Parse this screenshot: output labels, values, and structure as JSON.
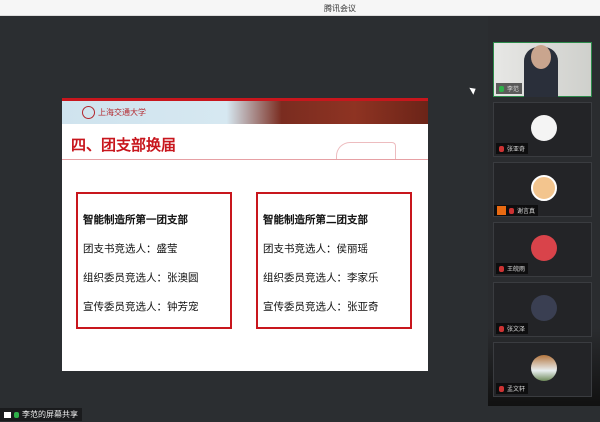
{
  "window": {
    "title": "腾讯会议"
  },
  "slide": {
    "university": "上海交通大学",
    "title": "四、团支部换届",
    "branches": [
      {
        "name": "智能制造所第一团支部",
        "rows": [
          "团支书竞选人：盛莹",
          "组织委员竞选人：张澳圆",
          "宣传委员竞选人：钟芳宠"
        ]
      },
      {
        "name": "智能制造所第二团支部",
        "rows": [
          "团支书竞选人：侯丽瑶",
          "组织委员竞选人：李家乐",
          "宣传委员竞选人：张亚奇"
        ]
      }
    ]
  },
  "participants": [
    {
      "name": "李范",
      "mic": "on",
      "video": true
    },
    {
      "name": "张亚奇",
      "mic": "muted",
      "avatar_color": "#f4f4f4"
    },
    {
      "name": "谢言真",
      "mic": "muted",
      "avatar_color": "#f3c58e",
      "host_badge": true
    },
    {
      "name": "王皖雨",
      "mic": "muted",
      "avatar_color": "#d9434a"
    },
    {
      "name": "张文泽",
      "mic": "muted",
      "avatar_color": "#3a3f52"
    },
    {
      "name": "孟文轩",
      "mic": "muted",
      "avatar_color": "#a7b6a0"
    }
  ],
  "share_label": "李范的屏幕共享",
  "colors": {
    "accent_red": "#c8161d",
    "active_border": "#2c8a4a"
  }
}
